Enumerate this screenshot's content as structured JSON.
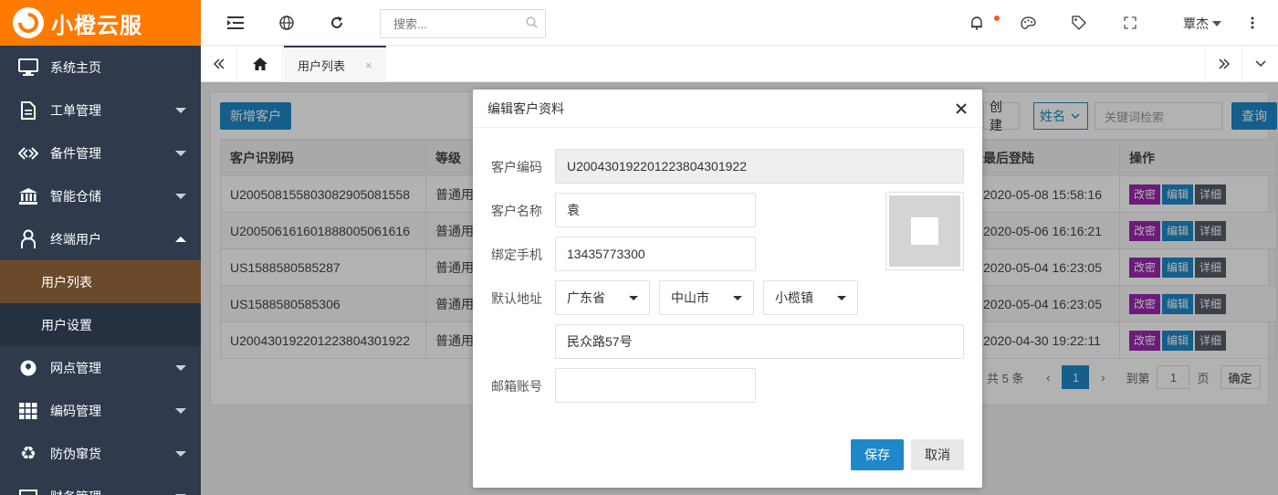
{
  "brand": {
    "name": "小橙云服"
  },
  "sidebar": {
    "items": [
      {
        "label": "系统主页"
      },
      {
        "label": "工单管理"
      },
      {
        "label": "备件管理"
      },
      {
        "label": "智能仓储"
      },
      {
        "label": "终端用户"
      },
      {
        "label": "网点管理"
      },
      {
        "label": "编码管理"
      },
      {
        "label": "防伪窜货"
      },
      {
        "label": "财务管理"
      }
    ],
    "subitems": [
      {
        "label": "用户列表"
      },
      {
        "label": "用户设置"
      }
    ]
  },
  "header": {
    "search_placeholder": "搜索...",
    "user_name": "覃杰"
  },
  "tabs": {
    "active_label": "用户列表",
    "close_glyph": "×"
  },
  "content": {
    "add_button": "新增客户",
    "filter_partial": "创建",
    "field_select": "姓名",
    "keyword_placeholder": "关键词检索",
    "query_button": "查询",
    "columns": [
      "客户识别码",
      "等级",
      "最后登陆",
      "操作"
    ],
    "rows": [
      {
        "code": "U20050815580308290508​1558",
        "level": "普通用",
        "last_login": "2020-05-08 15:58:16"
      },
      {
        "code": "U20050616160188800506​1616",
        "level": "普通用",
        "last_login": "2020-05-06 16:16:21"
      },
      {
        "code": "US1588580585287",
        "level": "普通用",
        "last_login": "2020-05-04 16:23:05"
      },
      {
        "code": "US1588580585306",
        "level": "普通用",
        "last_login": "2020-05-04 16:23:05"
      },
      {
        "code": "U20043019220122380430​1922",
        "level": "普通用",
        "last_login": "2020-04-30 19:22:11"
      }
    ],
    "actions": {
      "delete": "改密",
      "edit": "编辑",
      "detail": "详细"
    },
    "pager": {
      "total": "共 5 条",
      "current": "1",
      "goto_label": "到第",
      "goto_value": "1",
      "page_unit": "页",
      "confirm": "确定"
    }
  },
  "modal": {
    "title": "编辑客户资料",
    "fields": {
      "code_label": "客户编码",
      "code_value": "U200430192201223804301922",
      "name_label": "客户名称",
      "name_value": "袁",
      "phone_label": "绑定手机",
      "phone_value": "13435773300",
      "address_label": "默认地址",
      "province": "广东省",
      "city": "中山市",
      "town": "小榄镇",
      "street": "民众路57号",
      "email_label": "邮箱账号",
      "email_value": ""
    },
    "save_button": "保存",
    "cancel_button": "取消"
  }
}
